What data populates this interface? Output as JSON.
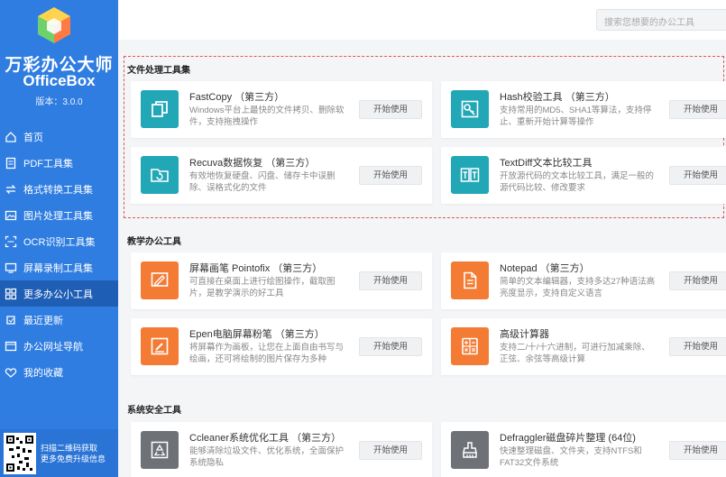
{
  "app": {
    "name_cn": "万彩办公大师",
    "name_en": "OfficeBox",
    "version": "版本：3.0.0"
  },
  "sidebar": {
    "items": [
      {
        "label": "首页",
        "icon": "home-icon"
      },
      {
        "label": "PDF工具集",
        "icon": "pdf-icon"
      },
      {
        "label": "格式转换工具集",
        "icon": "convert-icon"
      },
      {
        "label": "图片处理工具集",
        "icon": "image-icon"
      },
      {
        "label": "OCR识别工具集",
        "icon": "ocr-icon"
      },
      {
        "label": "屏幕录制工具集",
        "icon": "screen-record-icon"
      },
      {
        "label": "更多办公小工具",
        "icon": "more-tools-icon",
        "active": true
      },
      {
        "label": "最近更新",
        "icon": "recent-icon"
      },
      {
        "label": "办公网址导航",
        "icon": "link-icon"
      },
      {
        "label": "我的收藏",
        "icon": "favorite-icon"
      }
    ],
    "qr_text_line1": "扫描二维码获取",
    "qr_text_line2": "更多免费升级信息"
  },
  "search": {
    "placeholder": "搜索您想要的办公工具"
  },
  "sections": [
    {
      "title": "文件处理工具集",
      "cards": [
        {
          "name": "FastCopy （第三方）",
          "desc": "Windows平台上最快的文件拷贝、删除软件，支持拖拽操作",
          "button": "开始使用",
          "icon": "copy-icon",
          "color": "#21a7b6"
        },
        {
          "name": "Hash校验工具 （第三方）",
          "desc": "支持常用的MD5、SHA1等算法，支持停止、重新开始计算等操作",
          "button": "开始使用",
          "icon": "key-icon",
          "color": "#21a7b6"
        },
        {
          "name": "Recuva数据恢复 （第三方）",
          "desc": "有效地恢复硬盘、闪盘、储存卡中误删除、误格式化的文件",
          "button": "开始使用",
          "icon": "folder-recover-icon",
          "color": "#21a7b6"
        },
        {
          "name": "TextDiff文本比较工具",
          "desc": "开放源代码的文本比较工具，满足一般的源代码比较、修改要求",
          "button": "开始使用",
          "icon": "text-compare-icon",
          "color": "#21a7b6"
        }
      ]
    },
    {
      "title": "教学办公工具",
      "cards": [
        {
          "name": "屏幕画笔 Pointofix （第三方）",
          "desc": "可直接在桌面上进行绘图操作，截取图片，是教学演示的好工具",
          "button": "开始使用",
          "icon": "screen-pen-icon",
          "color": "#f47b34"
        },
        {
          "name": "Notepad （第三方）",
          "desc": "简单的文本编辑器，支持多达27种语法高亮度显示，支持自定义语言",
          "button": "开始使用",
          "icon": "notepad-icon",
          "color": "#f47b34"
        },
        {
          "name": "Epen电脑屏幕粉笔 （第三方）",
          "desc": "将屏幕作为画板，让您在上面自由书写与绘画，还可将绘制的图片保存为多种",
          "button": "开始使用",
          "icon": "chalk-icon",
          "color": "#f47b34"
        },
        {
          "name": "高级计算器",
          "desc": "支持二/十/十六进制，可进行加减乘除、正弦、余弦等高级计算",
          "button": "开始使用",
          "icon": "calculator-icon",
          "color": "#f47b34"
        }
      ]
    },
    {
      "title": "系统安全工具",
      "cards": [
        {
          "name": "Ccleaner系统优化工具 （第三方）",
          "desc": "能够清除垃圾文件、优化系统，全面保护系统隐私",
          "button": "开始使用",
          "icon": "recycle-icon",
          "color": "#6e7276"
        },
        {
          "name": "Defraggler磁盘碎片整理 (64位)",
          "desc": "快速整理磁盘、文件夹，支持NTFS和FAT32文件系统",
          "button": "开始使用",
          "icon": "defrag-icon",
          "color": "#6e7276"
        }
      ]
    }
  ]
}
